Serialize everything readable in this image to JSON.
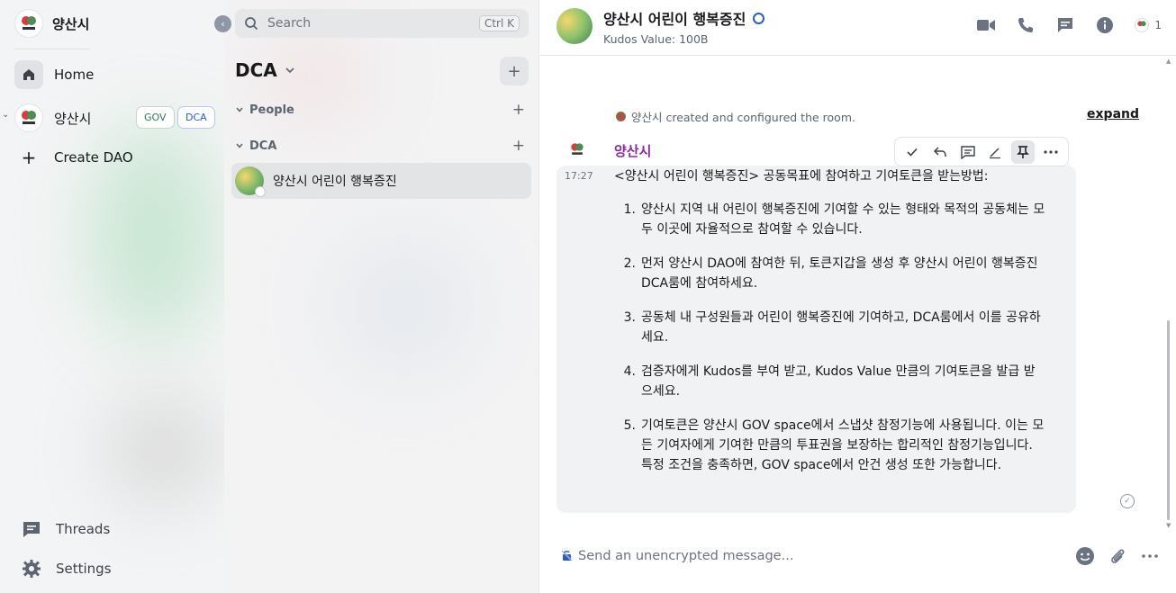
{
  "space": {
    "name": "양산시",
    "nav_home": "Home",
    "space_item": "양산시",
    "badges": [
      "GOV",
      "DCA"
    ],
    "create_dao": "Create DAO",
    "threads": "Threads",
    "settings": "Settings"
  },
  "room_list": {
    "search_placeholder": "Search",
    "search_shortcut": "Ctrl K",
    "title": "DCA",
    "sections": [
      "People",
      "DCA"
    ],
    "rooms": [
      {
        "name": "양산시 어린이 행복증진"
      }
    ]
  },
  "room": {
    "title": "양산시 어린이 행복증진",
    "subtitle": "Kudos Value: 100B",
    "member_count": "1",
    "notice": "양산시 created and configured the room.",
    "expand_label": "expand"
  },
  "message": {
    "sender": "양산시",
    "timestamp": "17:27",
    "intro": "<양산시 어린이 행복증진> 공동목표에 참여하고 기여토큰을 받는방법:",
    "items": [
      {
        "num": "1.",
        "text": "양산시 지역 내 어린이 행복증진에 기여할 수 있는 형태와 목적의 공동체는 모두 이곳에 자율적으로 참여할 수 있습니다."
      },
      {
        "num": "2.",
        "text": "먼저 양산시 DAO에 참여한 뒤, 토큰지갑을 생성 후 양산시 어린이 행복증진 DCA룸에 참여하세요."
      },
      {
        "num": "3.",
        "text": "공동체 내 구성원들과 어린이 행복증진에 기여하고, DCA룸에서 이를 공유하세요."
      },
      {
        "num": "4.",
        "text": "검증자에게 Kudos를 부여 받고, Kudos Value 만큼의 기여토큰을 발급 받으세요."
      },
      {
        "num": "5.",
        "text": "기여토큰은 양산시 GOV space에서 스냅샷 참정기능에 사용됩니다. 이는 모든 기여자에게 기여한 만큼의 투표권을 보장하는 합리적인 참정기능입니다. 특정 조건을 충족하면, GOV space에서 안건 생성 또한 가능합니다."
      }
    ]
  },
  "composer": {
    "placeholder": "Send an unencrypted message..."
  },
  "colors": {
    "sender_name": "#8b2a9a",
    "badge_gov": "#2c7a57",
    "badge_dca": "#2a5ec2",
    "accent_green": "#4d8b58"
  }
}
